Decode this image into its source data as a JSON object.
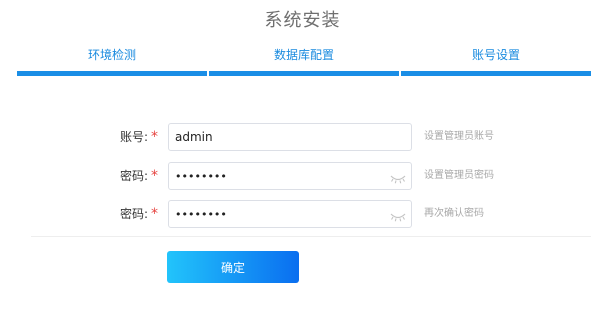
{
  "header": {
    "title": "系统安装"
  },
  "steps": [
    {
      "label": "环境检测"
    },
    {
      "label": "数据库配置"
    },
    {
      "label": "账号设置"
    }
  ],
  "form": {
    "account": {
      "label": "账号:",
      "required_mark": "*",
      "value": "admin",
      "hint": "设置管理员账号"
    },
    "password": {
      "label": "密码:",
      "required_mark": "*",
      "value": "12345678",
      "icon": "eye-closed-icon",
      "hint": "设置管理员密码"
    },
    "confirm_password": {
      "label": "密码:",
      "required_mark": "*",
      "value": "12345678",
      "icon": "eye-closed-icon",
      "hint": "再次确认密码"
    }
  },
  "actions": {
    "confirm_label": "确定"
  },
  "colors": {
    "accent": "#1a8ee6",
    "required": "#e64340",
    "button_gradient_start": "#22c4fb",
    "button_gradient_end": "#0a6ef0"
  }
}
